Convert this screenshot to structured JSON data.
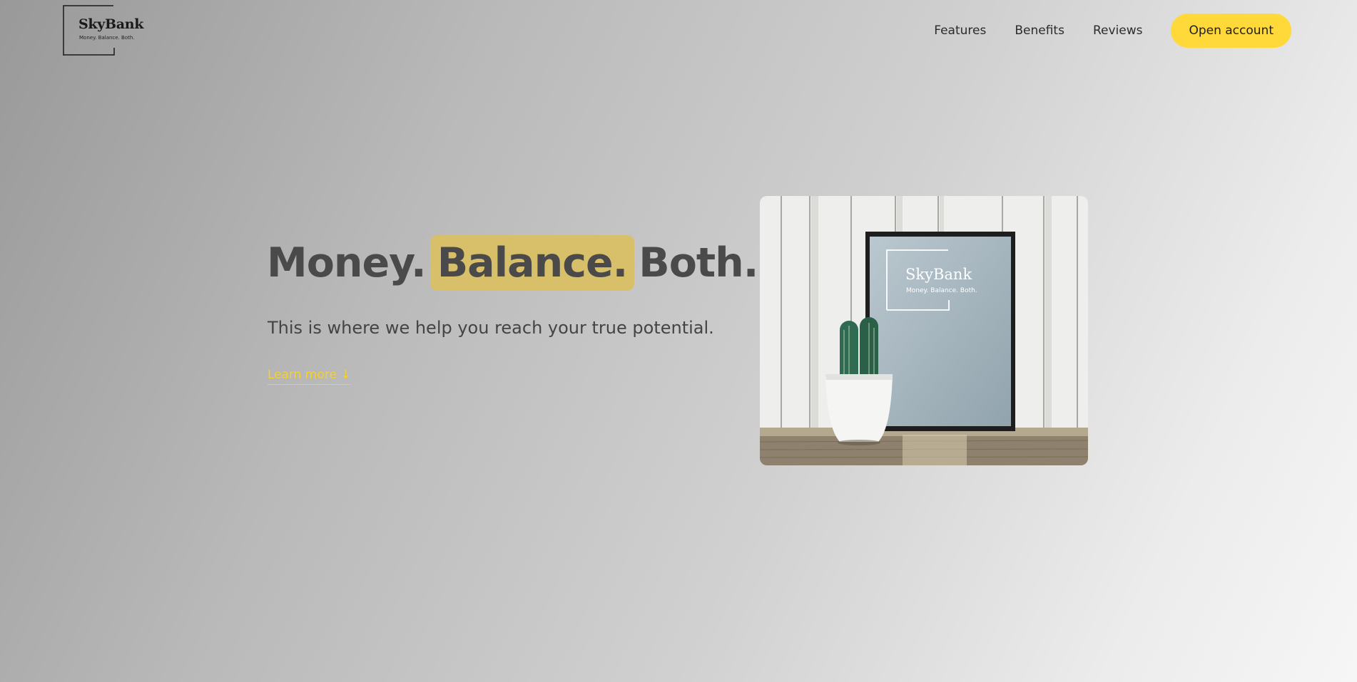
{
  "brand": {
    "name": "SkyBank",
    "tagline": "Money. Balance. Both."
  },
  "nav": {
    "links": [
      "Features",
      "Benefits",
      "Reviews"
    ],
    "cta_label": "Open account"
  },
  "hero": {
    "title_part1": "Money.",
    "title_highlight": "Balance.",
    "title_part3": "Both.",
    "subtitle": "This is where we help you reach your true potential.",
    "learn_more": "Learn more ↓"
  },
  "colors": {
    "accent": "#ffd83a",
    "highlight": "#d8c06b",
    "heading": "#4a4a4a",
    "link": "#f3d133"
  },
  "image": {
    "icon": "cactus-and-framed-logo-photo"
  }
}
